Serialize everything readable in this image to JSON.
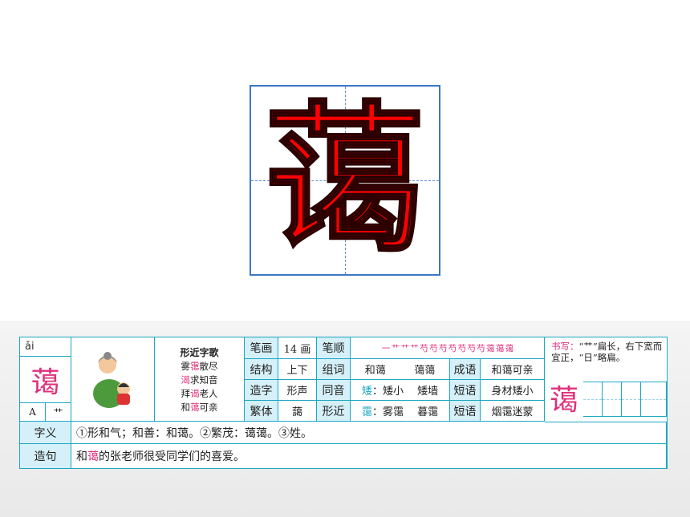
{
  "character": "蔼",
  "pinyin": "ǎi",
  "radical": "艹",
  "structure_letter": "A",
  "song": {
    "title": "形近字歌",
    "lines": [
      {
        "pre": "雾",
        "hl": "霭",
        "post": "散尽"
      },
      {
        "pre": "",
        "hl": "渴",
        "post": "求知音"
      },
      {
        "pre": "拜",
        "hl": "谒",
        "post": "老人"
      },
      {
        "pre": "和",
        "hl": "蔼",
        "post": "可亲"
      }
    ]
  },
  "info": {
    "strokes_label": "笔画",
    "strokes_value": "14 画",
    "order_label": "笔顺",
    "order_value": "一 艹 艹 艹 芍 芍 芍 芍 芍 芍 芍 蔼 蔼 蔼",
    "structure_label": "结构",
    "structure_value": "上下",
    "words_label": "组词",
    "words_value_1": "和蔼",
    "words_value_2": "蔼蔼",
    "idiom_label": "成语",
    "idiom_value": "和蔼可亲",
    "formation_label": "造字",
    "formation_value": "形声",
    "homophone_label": "同音",
    "homophone_char": "矮",
    "homophone_words": "：矮小　 矮墙",
    "phrase_label": "短语",
    "phrase_value_1": "身材矮小",
    "traditional_label": "繁体",
    "traditional_value": "藹",
    "similar_label": "形近",
    "similar_char": "霭",
    "similar_words": "：雾霭　 暮霭",
    "phrase_value_2": "烟霭迷蒙"
  },
  "writing": {
    "label": "书写：",
    "note": "“艹”扁长，右下宽而宜正，“日”略扁。",
    "char": "蔼"
  },
  "meaning": {
    "label": "字义",
    "text": "①形和气；和善：和蔼。②繁茂：蔼蔼。③姓。"
  },
  "sentence": {
    "label": "造句",
    "pre": "和",
    "hl": "蔼",
    "post": "的张老师很受同学们的喜爱。"
  }
}
